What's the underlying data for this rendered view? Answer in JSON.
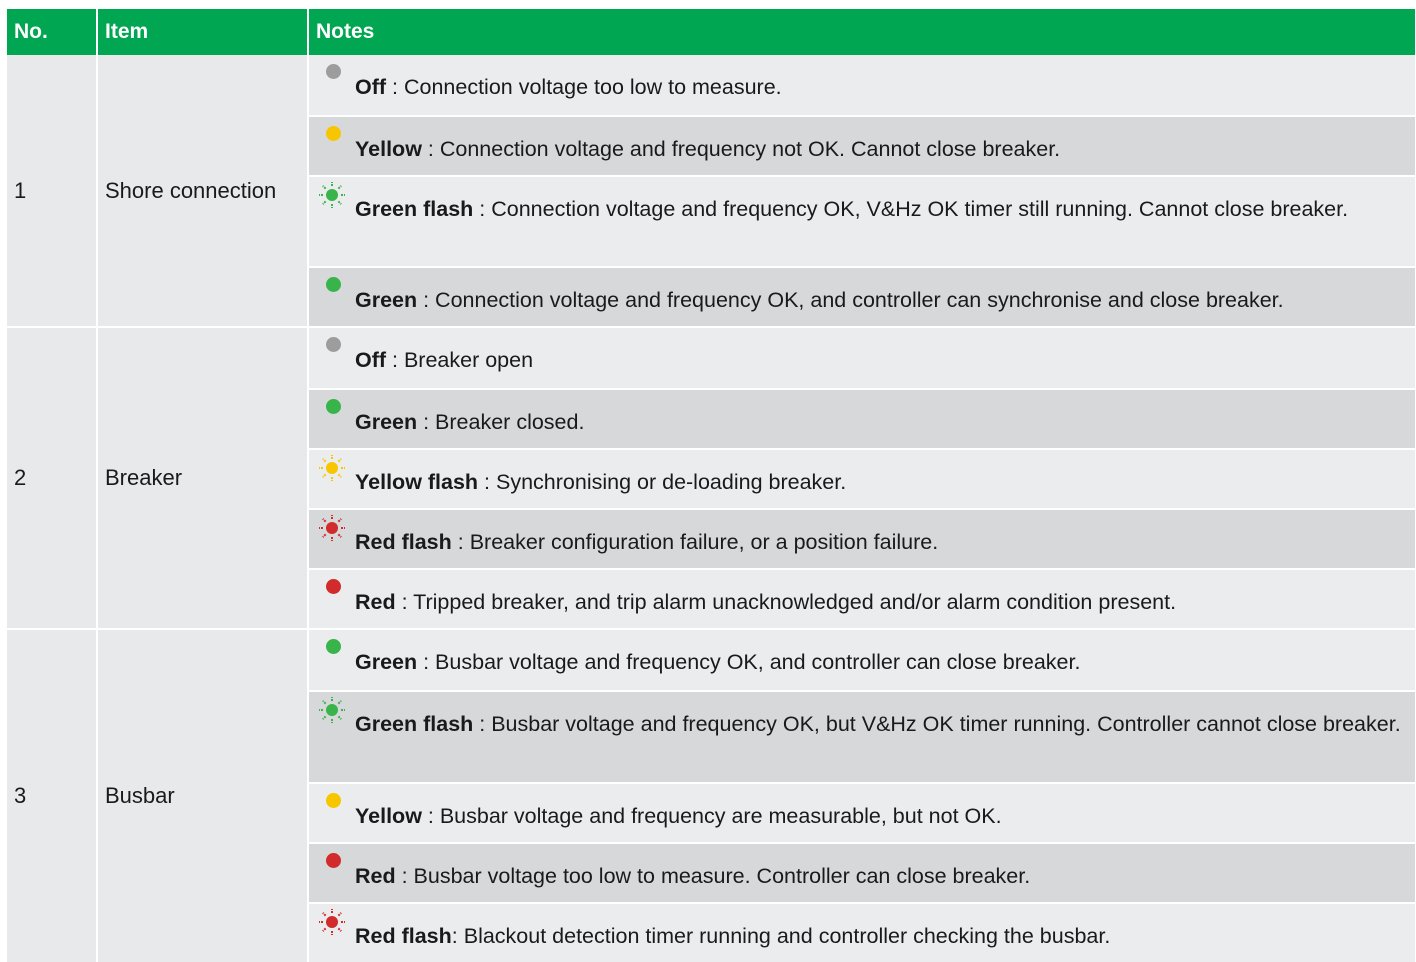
{
  "header": {
    "no": "No.",
    "item": "Item",
    "notes": "Notes"
  },
  "colors": {
    "header_green": "#00a651",
    "off": "#9d9d9d",
    "yellow": "#f7c600",
    "green": "#38b44a",
    "red": "#d22b2b"
  },
  "rows": [
    {
      "no": "1",
      "item": "Shore connection",
      "notes": [
        {
          "icon": "off-dot-icon",
          "label": "Off",
          "text": " : Connection voltage too low to measure."
        },
        {
          "icon": "yellow-dot-icon",
          "label": "Yellow",
          "text": " : Connection voltage and frequency not OK. Cannot close breaker."
        },
        {
          "icon": "green-flash-icon",
          "label": "Green flash",
          "text": " : Connection voltage and frequency OK, V&Hz OK timer still running. Cannot close breaker."
        },
        {
          "icon": "green-dot-icon",
          "label": "Green",
          "text": " : Connection voltage and frequency OK, and controller can synchronise and close breaker."
        }
      ]
    },
    {
      "no": "2",
      "item": "Breaker",
      "notes": [
        {
          "icon": "off-dot-icon",
          "label": "Off",
          "text": " : Breaker open"
        },
        {
          "icon": "green-dot-icon",
          "label": "Green",
          "text": " : Breaker closed."
        },
        {
          "icon": "yellow-flash-icon",
          "label": "Yellow flash",
          "text": " : Synchronising or de-loading breaker."
        },
        {
          "icon": "red-flash-icon",
          "label": "Red flash",
          "text": " : Breaker configuration failure, or a position failure."
        },
        {
          "icon": "red-dot-icon",
          "label": "Red",
          "text": " : Tripped breaker, and trip alarm unacknowledged and/or alarm condition present."
        }
      ]
    },
    {
      "no": "3",
      "item": "Busbar",
      "notes": [
        {
          "icon": "green-dot-icon",
          "label": "Green",
          "text": " : Busbar voltage and frequency OK, and controller can close breaker."
        },
        {
          "icon": "green-flash-icon",
          "label": "Green flash",
          "text": " : Busbar voltage and frequency OK, but V&Hz OK timer running. Controller cannot close breaker."
        },
        {
          "icon": "yellow-dot-icon",
          "label": "Yellow",
          "text": " : Busbar voltage and frequency are measurable, but not OK."
        },
        {
          "icon": "red-dot-icon",
          "label": "Red",
          "text": " : Busbar voltage too low to measure. Controller can close breaker."
        },
        {
          "icon": "red-flash-icon",
          "label": "Red flash",
          "text": ": Blackout detection timer running and controller checking the busbar."
        }
      ]
    }
  ]
}
